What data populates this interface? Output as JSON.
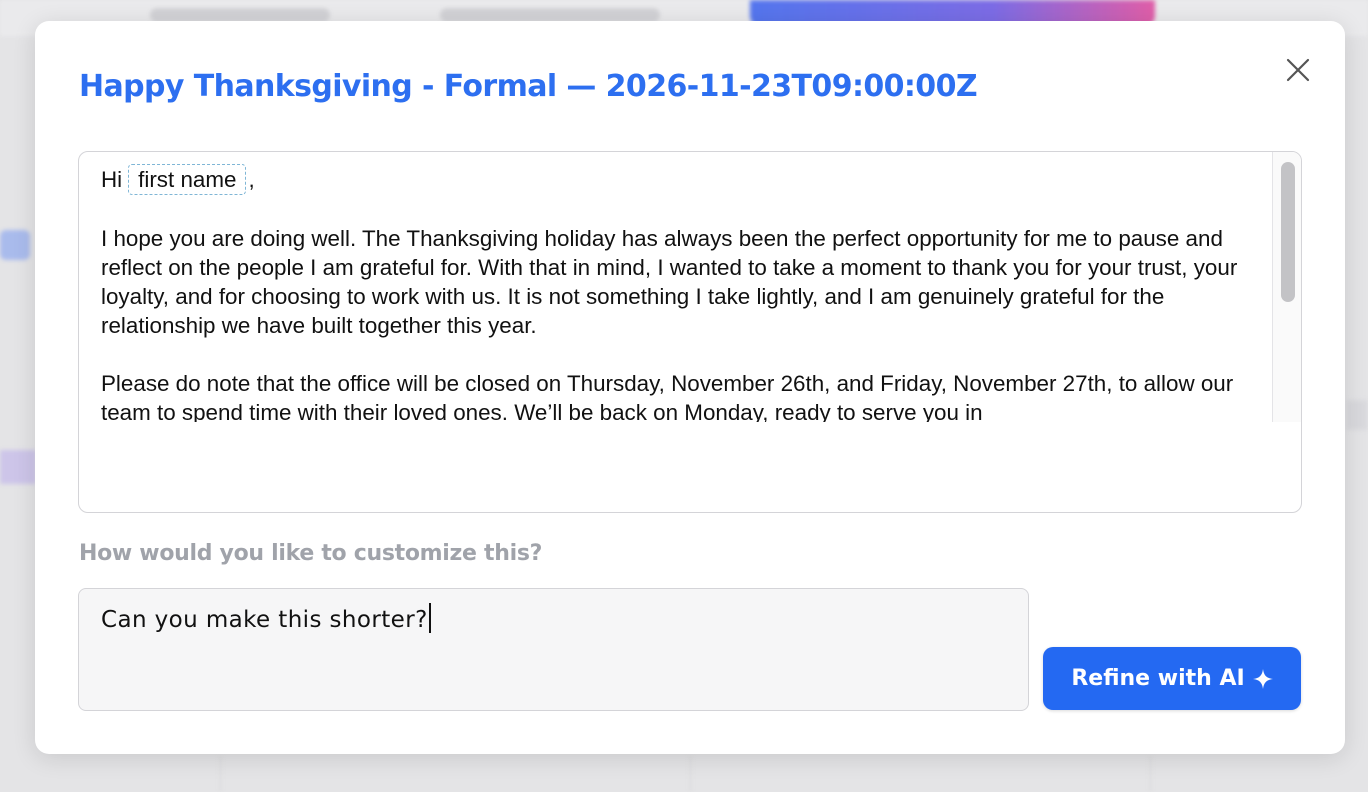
{
  "modal": {
    "title": "Happy Thanksgiving - Formal — 2026-11-23T09:00:00Z",
    "close_icon": "close-icon"
  },
  "editor": {
    "greeting_prefix": "Hi",
    "token_label": "first name",
    "greeting_suffix": ",",
    "paragraphs": [
      "I hope you are doing well. The Thanksgiving holiday has always been the perfect opportunity for me to pause and reflect on the people I am grateful for. With that in mind, I wanted to take a moment to thank you for your trust, your loyalty, and for choosing to work with us. It is not something I take lightly, and I am genuinely grateful for the relationship we have built together this year.",
      "Please do note that the office will be closed on Thursday, November 26th, and Friday, November 27th, to allow our team to spend time with their loved ones. We’ll be back on Monday, ready to serve you in"
    ]
  },
  "customize": {
    "label": "How would you like to customize this?",
    "input_value": "Can you make this shorter?",
    "refine_label": "Refine with AI",
    "refine_icon": "sparkle-icon"
  },
  "colors": {
    "accent": "#2469f2",
    "title": "#2d6ff0",
    "muted_label": "#a0a3aa"
  }
}
